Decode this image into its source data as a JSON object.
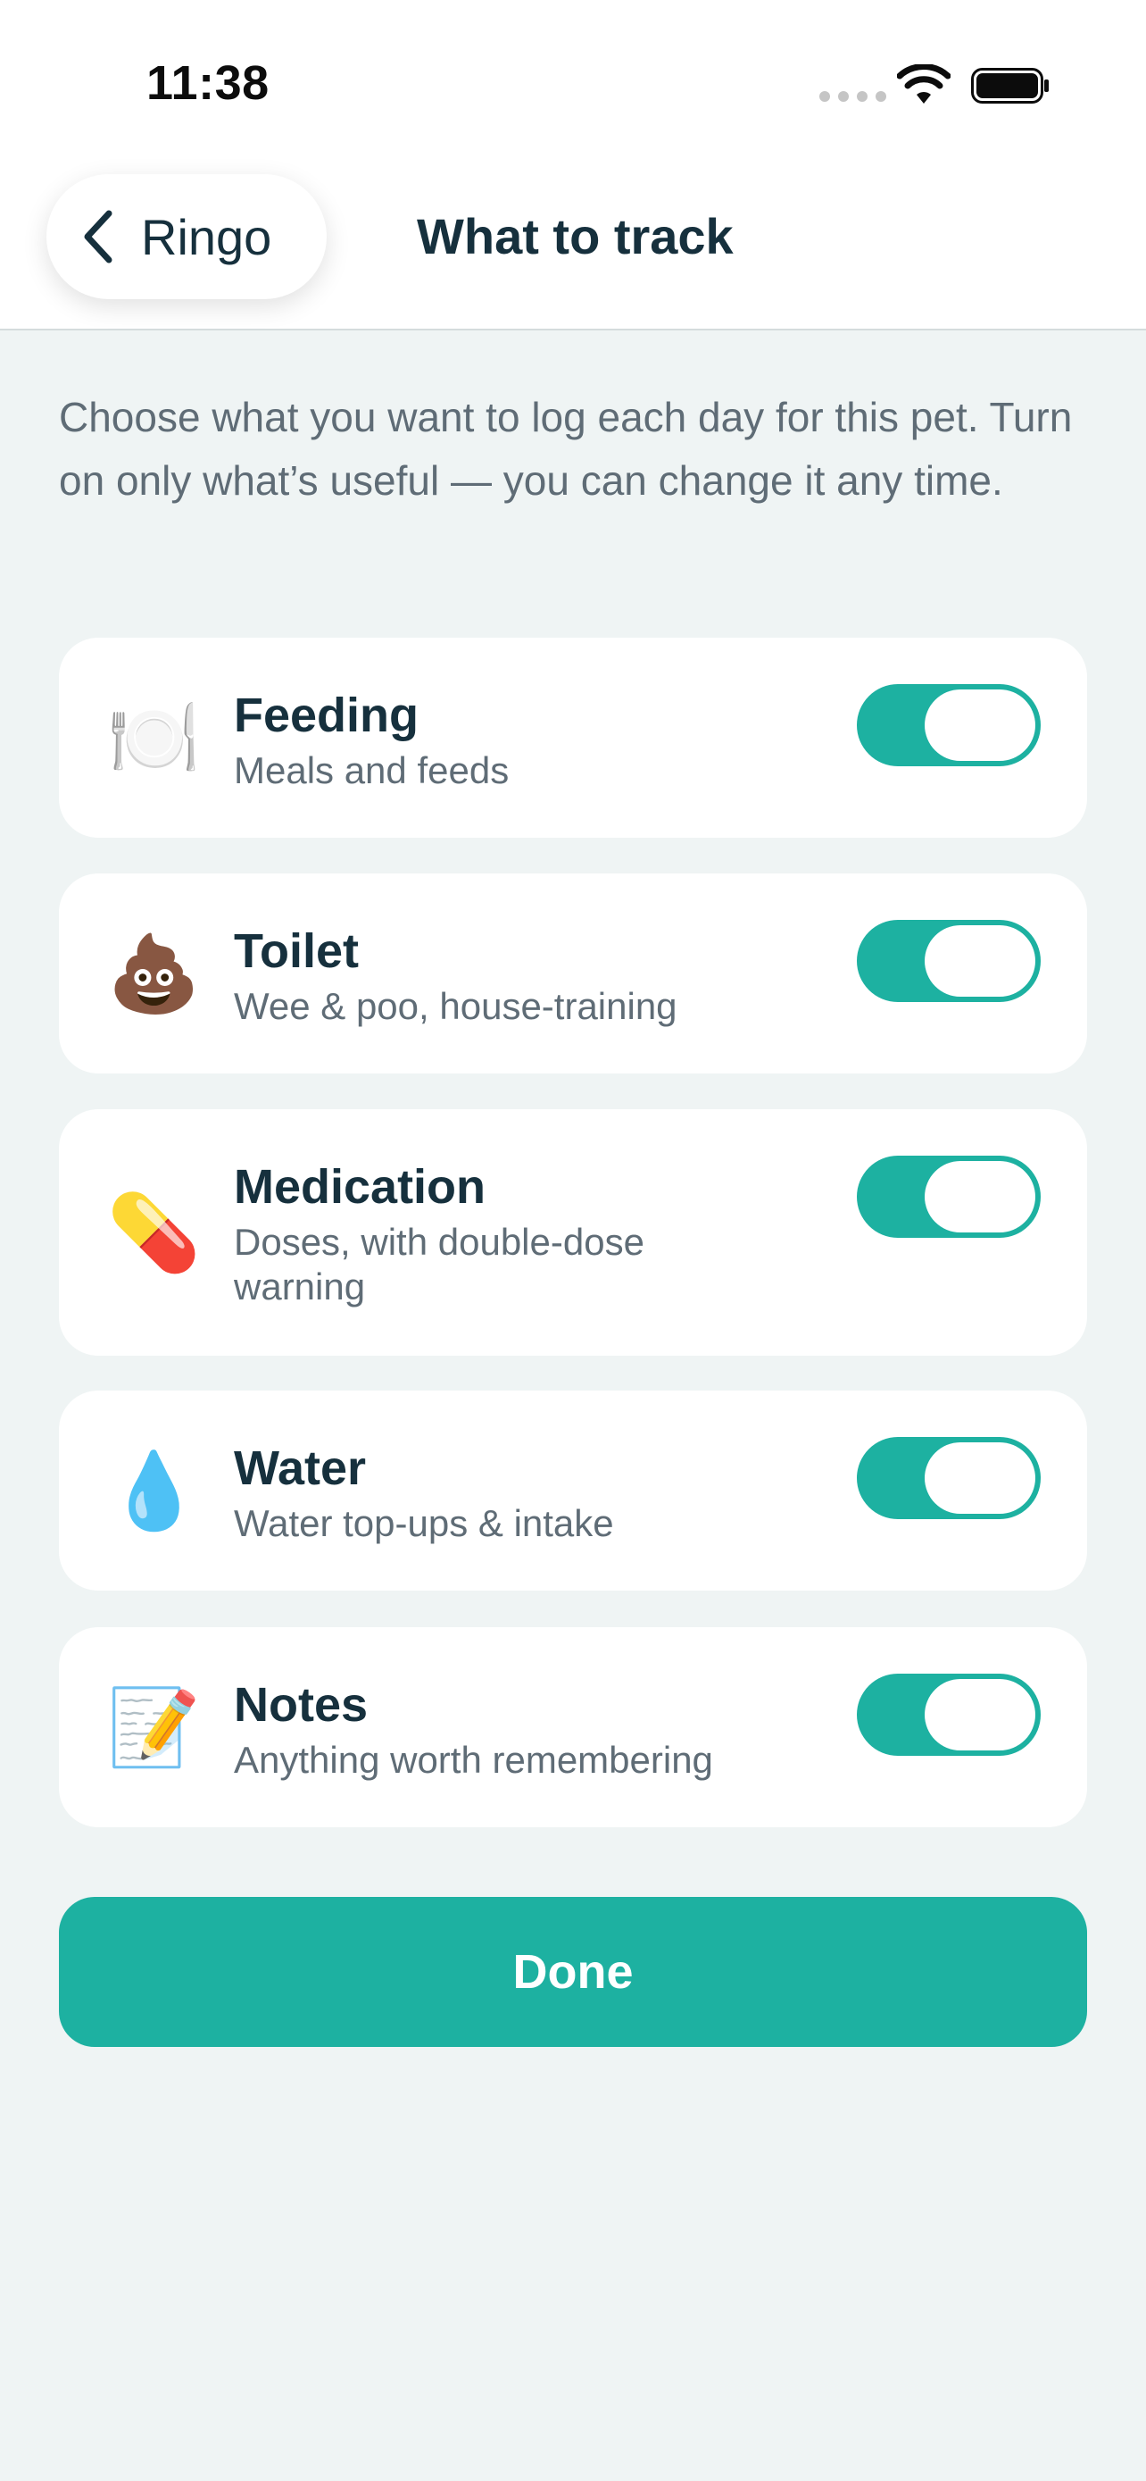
{
  "status_bar": {
    "time": "11:38",
    "icons": [
      "cellular-signal-icon",
      "wifi-icon",
      "battery-icon"
    ]
  },
  "nav": {
    "back_label": "Ringo",
    "title": "What to track"
  },
  "intro": "Choose what you want to log each day for this pet. Turn on only what’s useful — you can change it any time.",
  "accent_color": "#1db1a1",
  "trackers": [
    {
      "emoji": "🍽️",
      "icon_name": "plate-utensils-icon",
      "title": "Feeding",
      "subtitle": "Meals and feeds",
      "enabled": true
    },
    {
      "emoji": "💩",
      "icon_name": "poop-icon",
      "title": "Toilet",
      "subtitle": "Wee & poo, house-training",
      "enabled": true
    },
    {
      "emoji": "💊",
      "icon_name": "pill-icon",
      "title": "Medication",
      "subtitle": "Doses, with double-dose warning",
      "enabled": true
    },
    {
      "emoji": "💧",
      "icon_name": "droplet-icon",
      "title": "Water",
      "subtitle": "Water top-ups & intake",
      "enabled": true
    },
    {
      "emoji": "📝",
      "icon_name": "memo-icon",
      "title": "Notes",
      "subtitle": "Anything worth remembering",
      "enabled": true
    }
  ],
  "done_label": "Done"
}
